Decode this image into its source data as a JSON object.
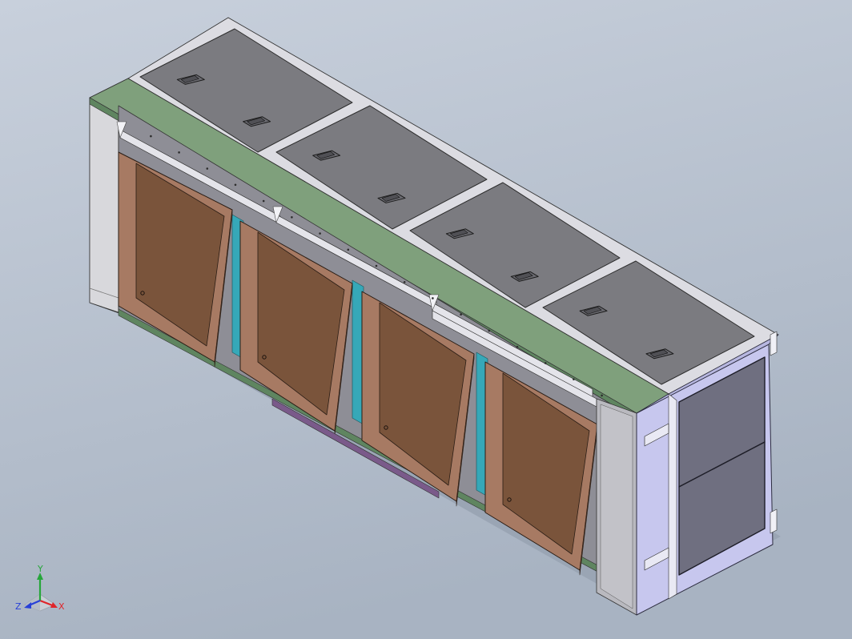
{
  "viewport": {
    "background_top": "#c3ccd8",
    "background_bottom": "#a9b5c4"
  },
  "model": {
    "cabinet_count": 4,
    "lid_count": 4,
    "colors": {
      "frame_light": "#d8d8dc",
      "frame_mid": "#b9b9bf",
      "frame_shadow": "#9c9ca4",
      "lid": "#7b7b80",
      "lid_dark": "#6a6a70",
      "top_rail": "#7fa07c",
      "top_rail_dark": "#5f8560",
      "door_face": "#7a543b",
      "door_frame": "#a77a63",
      "door_frame_dark": "#8d6450",
      "duct": "#36a8b8",
      "end_panel": "#c7c7ee",
      "end_window": "#6f6f80",
      "bracket": "#e9e9f4"
    }
  },
  "triad": {
    "x_label": "X",
    "y_label": "Y",
    "z_label": "Z",
    "x_color": "#e0252a",
    "y_color": "#26a63a",
    "z_color": "#2740d8"
  }
}
